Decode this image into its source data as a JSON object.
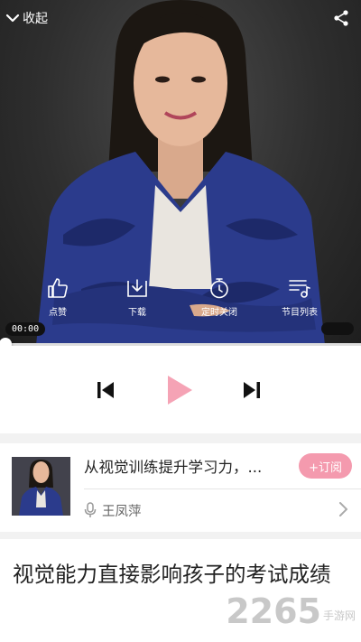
{
  "player": {
    "collapse_label": "收起",
    "current_time": "00:00",
    "progress": 0,
    "actions": [
      {
        "label": "点赞",
        "icon": "thumbs-up-icon"
      },
      {
        "label": "下载",
        "icon": "download-icon"
      },
      {
        "label": "定时关闭",
        "icon": "timer-icon"
      },
      {
        "label": "节目列表",
        "icon": "playlist-icon"
      }
    ],
    "controls": {
      "prev_icon": "skip-previous-icon",
      "play_icon": "play-icon",
      "next_icon": "skip-next-icon"
    },
    "colors": {
      "accent": "#f49aae",
      "play": "#f5a3b5"
    }
  },
  "program": {
    "title": "从视觉训练提升学习力，...",
    "subscribe_label": "+订阅",
    "author": "王凤萍"
  },
  "article": {
    "title": "视觉能力直接影响孩子的考试成绩"
  },
  "watermark": {
    "big": "2265",
    "small": "手游网"
  }
}
